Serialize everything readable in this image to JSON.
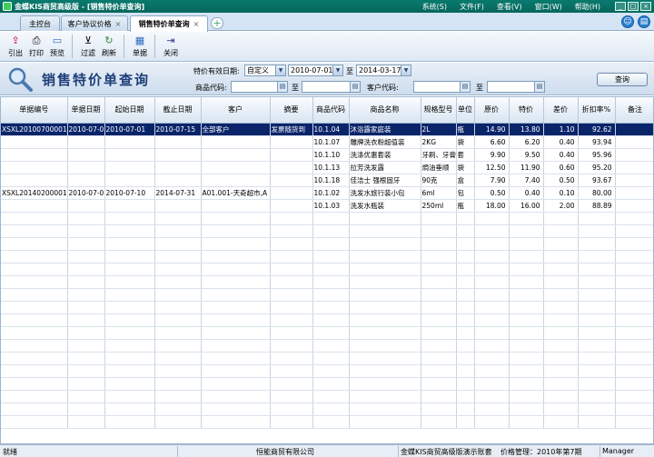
{
  "app": {
    "title": "金蝶KIS商贸高级版 - [销售特价单查询]",
    "menus": [
      "系统(S)",
      "文件(F)",
      "查看(V)",
      "窗口(W)",
      "帮助(H)"
    ],
    "window_buttons": [
      "_",
      "□",
      "×"
    ]
  },
  "tabs": [
    {
      "label": "主控台"
    },
    {
      "label": "客户协议价格"
    },
    {
      "label": "销售特价单查询"
    }
  ],
  "tab_close": "×",
  "tab_add": "+",
  "toolbar": {
    "items": [
      {
        "label": "引出",
        "icon": "export-icon"
      },
      {
        "label": "打印",
        "icon": "print-icon"
      },
      {
        "label": "预览",
        "icon": "preview-icon"
      },
      {
        "label": "过滤",
        "icon": "filter-icon"
      },
      {
        "label": "刷新",
        "icon": "refresh-icon"
      },
      {
        "label": "单据",
        "icon": "document-icon"
      },
      {
        "label": "关闭",
        "icon": "close-door-icon"
      }
    ]
  },
  "query": {
    "title": "销售特价单查询",
    "date_label": "特价有效日期:",
    "date_mode": "自定义",
    "date_from": "2010-07-01",
    "date_to_label": "至",
    "date_to": "2014-03-17",
    "product_code_label": "商品代码:",
    "product_from": "",
    "product_to_label": "至",
    "product_to": "",
    "customer_code_label": "客户代码:",
    "customer_from": "",
    "customer_to_label": "至",
    "customer_to": "",
    "query_button": "查询"
  },
  "table": {
    "columns": [
      "单据编号",
      "单据日期",
      "起始日期",
      "截止日期",
      "客户",
      "摘要",
      "商品代码",
      "商品名称",
      "规格型号",
      "单位",
      "原价",
      "特价",
      "差价",
      "折扣率%",
      "备注"
    ],
    "rows": [
      [
        "XSXL20100700001",
        "2010-07-0",
        "2010-07-01",
        "2010-07-15",
        "全部客户",
        "发票随货到",
        "10.1.04",
        "沐浴露家庭装",
        "2L",
        "瓶",
        "14.90",
        "13.80",
        "1.10",
        "92.62",
        ""
      ],
      [
        "",
        "",
        "",
        "",
        "",
        "",
        "10.1.07",
        "雕牌洗衣粉超值装",
        "2KG",
        "袋",
        "6.60",
        "6.20",
        "0.40",
        "93.94",
        ""
      ],
      [
        "",
        "",
        "",
        "",
        "",
        "",
        "10.1.10",
        "洗涤优惠套装",
        "牙刷、牙膏套",
        "套",
        "9.90",
        "9.50",
        "0.40",
        "95.96",
        ""
      ],
      [
        "",
        "",
        "",
        "",
        "",
        "",
        "10.1.13",
        "拉芳洗发露",
        "焗油垂顺",
        "袋",
        "12.50",
        "11.90",
        "0.60",
        "95.20",
        ""
      ],
      [
        "",
        "",
        "",
        "",
        "",
        "",
        "10.1.18",
        "佳洁士 强根固牙",
        "90克",
        "盒",
        "7.90",
        "7.40",
        "0.50",
        "93.67",
        ""
      ],
      [
        "XSXL20140200001",
        "2010-07-0",
        "2010-07-10",
        "2014-07-31",
        "A01.001-天奇超市,A",
        "",
        "10.1.02",
        "洗发水旅行装小包",
        "6ml",
        "包",
        "0.50",
        "0.40",
        "0.10",
        "80.00",
        ""
      ],
      [
        "",
        "",
        "",
        "",
        "",
        "",
        "10.1.03",
        "洗发水瓶装",
        "250ml",
        "瓶",
        "18.00",
        "16.00",
        "2.00",
        "88.89",
        ""
      ]
    ]
  },
  "status": {
    "state": "就绪",
    "company": "恒能商贸有限公司",
    "account": "金蝶KIS商贸高级版演示账套",
    "period": "价格管理：2010年第7期",
    "user": "Manager"
  },
  "colors": {
    "selected_row": "#0a246a",
    "title_bar": "#0a7a6e",
    "page_title": "#1e3f79"
  }
}
